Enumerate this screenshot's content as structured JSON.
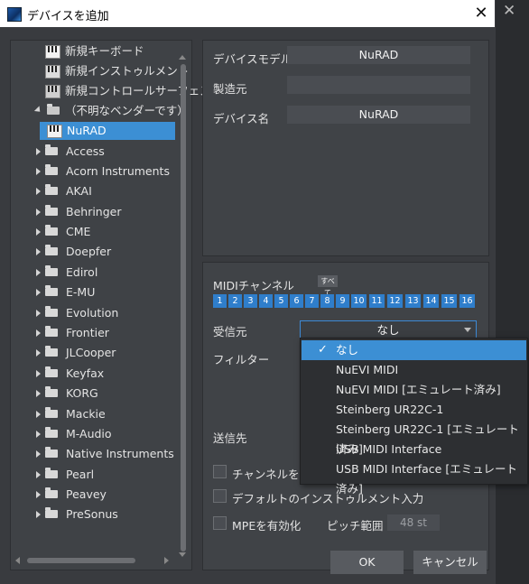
{
  "window": {
    "title": "デバイスを追加",
    "close_glyph": "✕"
  },
  "tree": {
    "items": [
      {
        "label": "新規キーボード",
        "icon": "keyboard-icon",
        "level": 2
      },
      {
        "label": "新規インストゥルメント",
        "icon": "instrument-icon",
        "level": 2
      },
      {
        "label": "新規コントロールサーフェス",
        "icon": "control-surface-icon",
        "level": 2
      },
      {
        "label": "（不明なベンダーです）",
        "icon": "folder-open-icon",
        "level": 1,
        "expanded": true
      },
      {
        "label": "NuRAD",
        "icon": "keyboard-icon",
        "level": 3,
        "selected": true
      },
      {
        "label": "Access",
        "icon": "folder-icon",
        "level": 1
      },
      {
        "label": "Acorn Instruments",
        "icon": "folder-icon",
        "level": 1
      },
      {
        "label": "AKAI",
        "icon": "folder-icon",
        "level": 1
      },
      {
        "label": "Behringer",
        "icon": "folder-icon",
        "level": 1
      },
      {
        "label": "CME",
        "icon": "folder-icon",
        "level": 1
      },
      {
        "label": "Doepfer",
        "icon": "folder-icon",
        "level": 1
      },
      {
        "label": "Edirol",
        "icon": "folder-icon",
        "level": 1
      },
      {
        "label": "E-MU",
        "icon": "folder-icon",
        "level": 1
      },
      {
        "label": "Evolution",
        "icon": "folder-icon",
        "level": 1
      },
      {
        "label": "Frontier",
        "icon": "folder-icon",
        "level": 1
      },
      {
        "label": "JLCooper",
        "icon": "folder-icon",
        "level": 1
      },
      {
        "label": "Keyfax",
        "icon": "folder-icon",
        "level": 1
      },
      {
        "label": "KORG",
        "icon": "folder-icon",
        "level": 1
      },
      {
        "label": "Mackie",
        "icon": "folder-icon",
        "level": 1
      },
      {
        "label": "M-Audio",
        "icon": "folder-icon",
        "level": 1
      },
      {
        "label": "Native Instruments",
        "icon": "folder-icon",
        "level": 1
      },
      {
        "label": "Pearl",
        "icon": "folder-icon",
        "level": 1
      },
      {
        "label": "Peavey",
        "icon": "folder-icon",
        "level": 1
      },
      {
        "label": "PreSonus",
        "icon": "folder-icon",
        "level": 1
      }
    ]
  },
  "device": {
    "model_label": "デバイスモデル",
    "model_value": "NuRAD",
    "manufacturer_label": "製造元",
    "manufacturer_value": "",
    "name_label": "デバイス名",
    "name_value": "NuRAD"
  },
  "midi": {
    "channel_label": "MIDIチャンネル",
    "all_label": "すべて",
    "channels": [
      "1",
      "2",
      "3",
      "4",
      "5",
      "6",
      "7",
      "8",
      "9",
      "10",
      "11",
      "12",
      "13",
      "14",
      "15",
      "16"
    ],
    "receive_label": "受信元",
    "receive_value": "なし",
    "filter_label": "フィルター",
    "send_label": "送信先",
    "split_channel_label": "チャンネルを分割",
    "default_instrument_label": "デフォルトのインストゥルメント入力",
    "mpe_label": "MPEを有効化",
    "pitch_range_label": "ピッチ範囲",
    "pitch_range_value": "48 st"
  },
  "dropdown": {
    "items": [
      {
        "label": "なし",
        "selected": true
      },
      {
        "label": "NuEVI MIDI"
      },
      {
        "label": "NuEVI MIDI [エミュレート済み]"
      },
      {
        "label": "Steinberg UR22C-1"
      },
      {
        "label": "Steinberg UR22C-1 [エミュレート済み]"
      },
      {
        "label": "USB MIDI Interface"
      },
      {
        "label": "USB MIDI Interface [エミュレート済み]"
      }
    ],
    "check_glyph": "✓"
  },
  "buttons": {
    "ok": "OK",
    "cancel": "キャンセル"
  },
  "colors": {
    "accent": "#3c8fd4",
    "channel": "#2f7ecb",
    "panel": "#404347",
    "background": "#393b3f"
  }
}
